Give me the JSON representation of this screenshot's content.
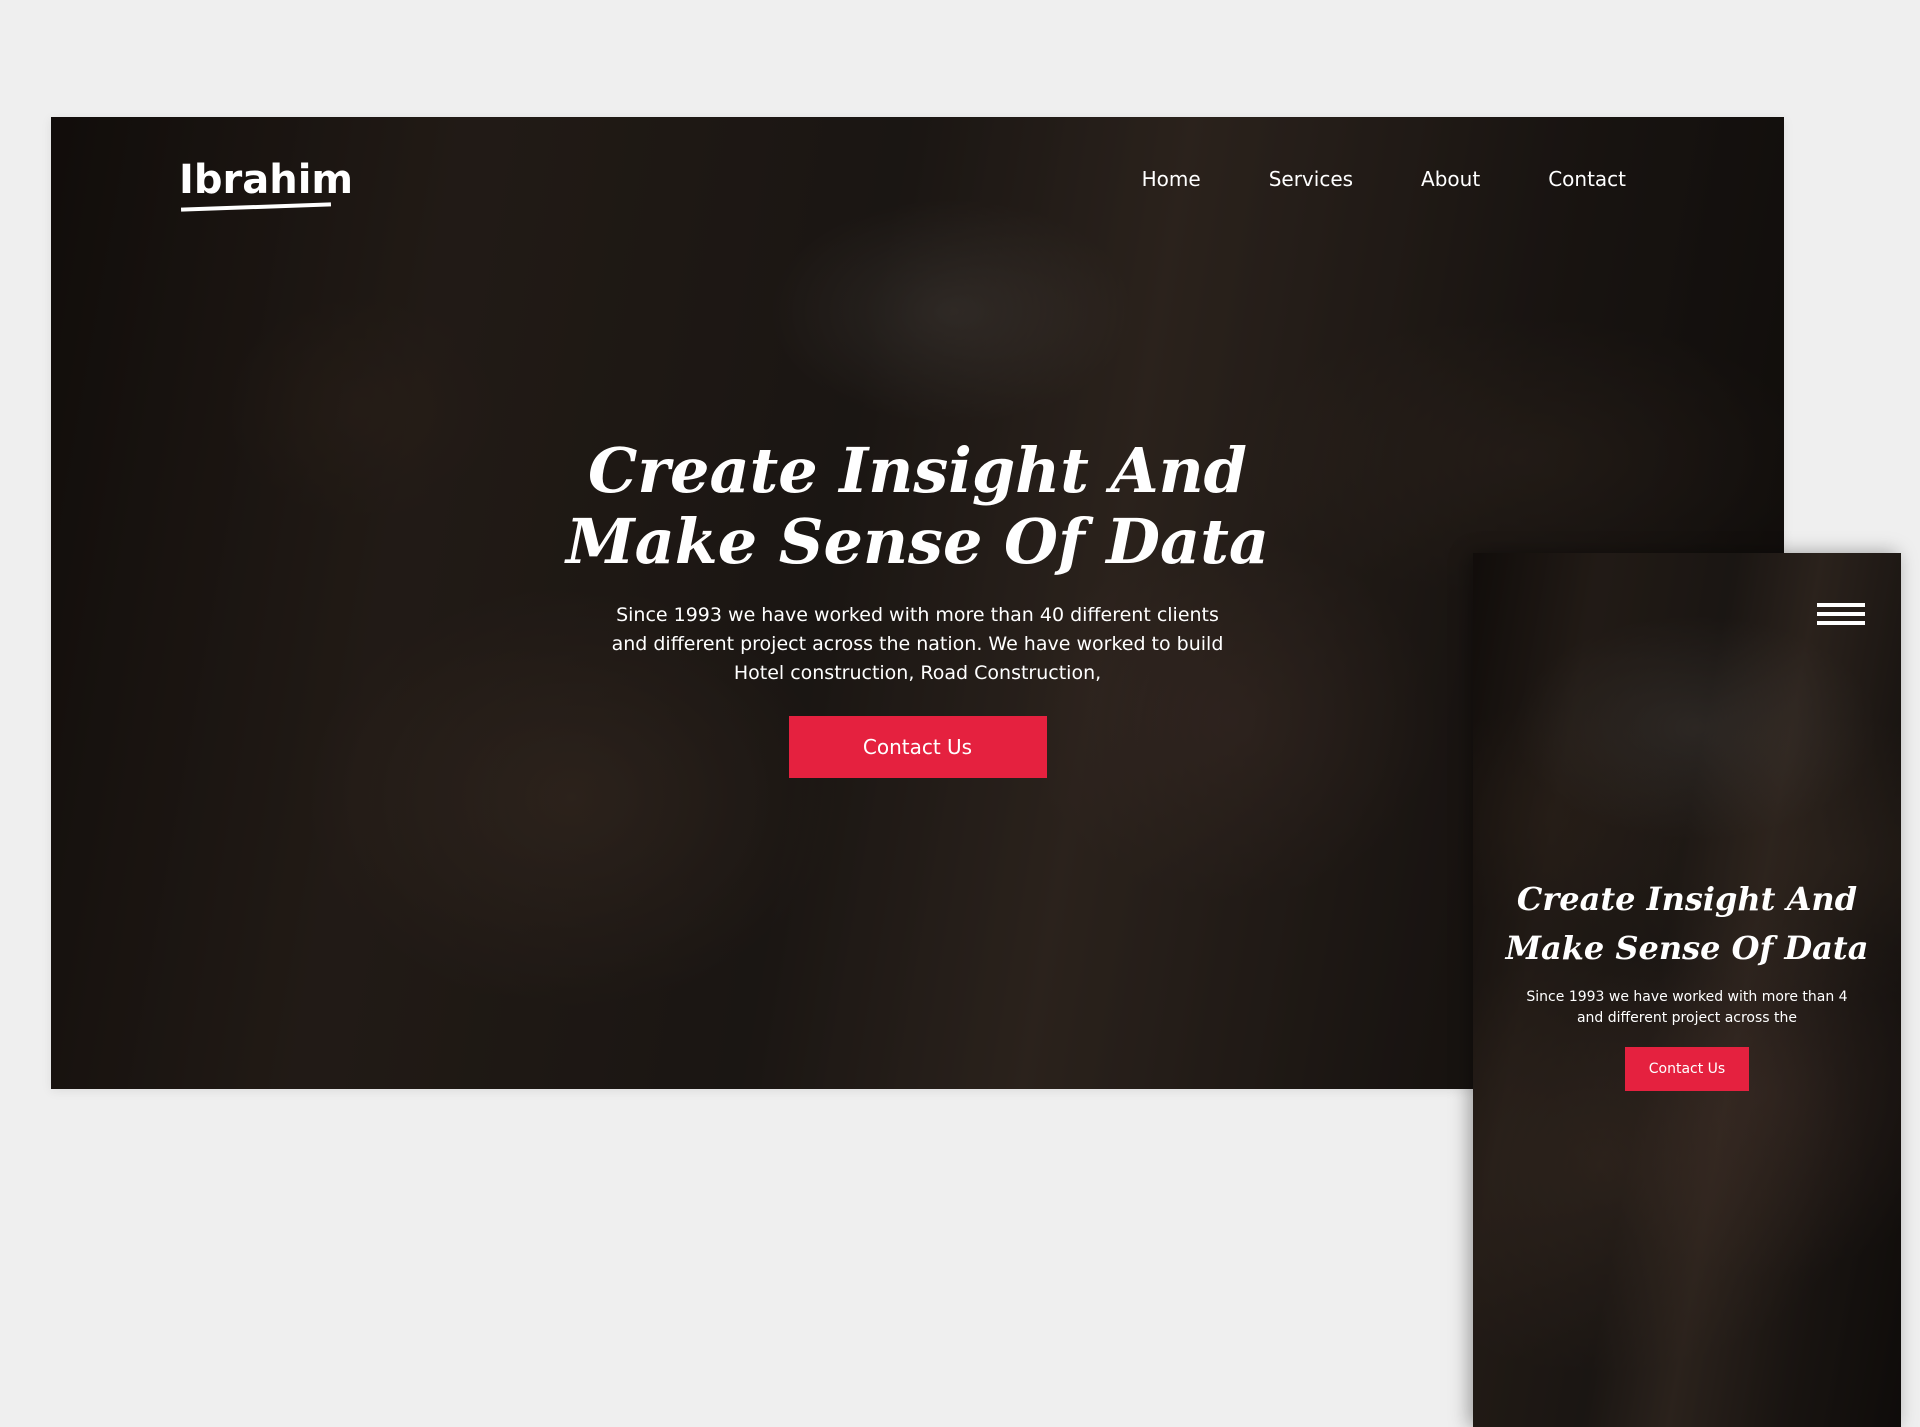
{
  "desktop": {
    "logo": "Ibrahim",
    "nav": {
      "home": "Home",
      "services": "Services",
      "about": "About",
      "contact": "Contact"
    },
    "hero": {
      "title_line1": "Create Insight And",
      "title_line2": "Make Sense Of Data",
      "text": "Since 1993 we have worked with more than 40 different clients and different project across the nation. We have worked to build Hotel construction, Road Construction,",
      "cta": "Contact Us"
    }
  },
  "mobile": {
    "menu_icon": "hamburger-menu-icon",
    "hero": {
      "title_line1": "Create Insight And",
      "title_line2": "Make Sense Of Data",
      "text": "Since 1993 we have worked with more than 4\nand different project across the",
      "cta": "Contact Us"
    }
  },
  "colors": {
    "page_background": "#efefef",
    "accent": "#e5213f",
    "text": "#ffffff"
  }
}
